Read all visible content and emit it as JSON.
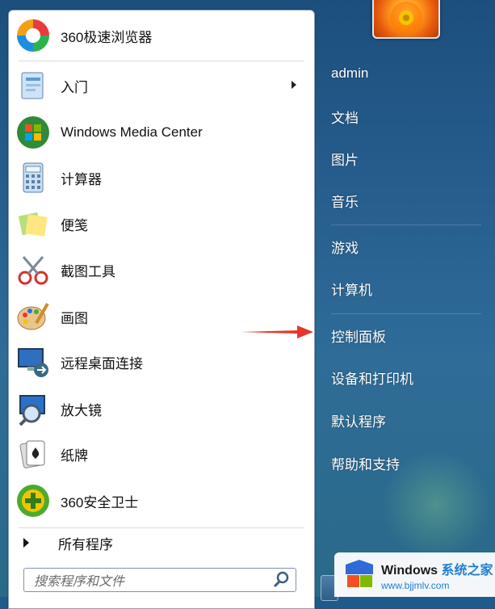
{
  "programs": [
    {
      "label": "360极速浏览器",
      "icon": "360-browser-icon",
      "has_submenu": false
    },
    {
      "label": "入门",
      "icon": "getting-started-icon",
      "has_submenu": true
    },
    {
      "label": "Windows Media Center",
      "icon": "media-center-icon",
      "has_submenu": false
    },
    {
      "label": "计算器",
      "icon": "calculator-icon",
      "has_submenu": false
    },
    {
      "label": "便笺",
      "icon": "sticky-notes-icon",
      "has_submenu": false
    },
    {
      "label": "截图工具",
      "icon": "snipping-tool-icon",
      "has_submenu": false
    },
    {
      "label": "画图",
      "icon": "paint-icon",
      "has_submenu": false
    },
    {
      "label": "远程桌面连接",
      "icon": "remote-desktop-icon",
      "has_submenu": false
    },
    {
      "label": "放大镜",
      "icon": "magnifier-icon",
      "has_submenu": false
    },
    {
      "label": "纸牌",
      "icon": "solitaire-icon",
      "has_submenu": false
    },
    {
      "label": "360安全卫士",
      "icon": "360-safe-icon",
      "has_submenu": false
    }
  ],
  "all_programs": "所有程序",
  "search": {
    "placeholder": "搜索程序和文件"
  },
  "right_items": [
    "admin",
    "文档",
    "图片",
    "音乐",
    "游戏",
    "计算机",
    "控制面板",
    "设备和打印机",
    "默认程序",
    "帮助和支持"
  ],
  "watermark": {
    "brand": "Windows",
    "suffix": "系统之家",
    "url": "www.bjjmlv.com"
  },
  "colors": {
    "arrow": "#e8352b",
    "accent": "#1f7fd0"
  }
}
